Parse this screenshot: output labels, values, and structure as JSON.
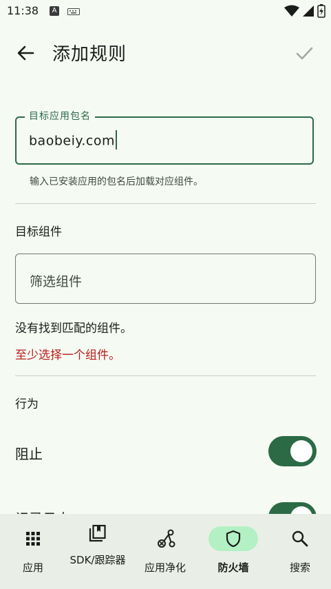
{
  "status_bar": {
    "time": "11:38",
    "notif_letter": "A"
  },
  "app_bar": {
    "title": "添加规则"
  },
  "package_field": {
    "label": "目标应用包名",
    "value": "baobeiy.com",
    "helper": "输入已安装应用的包名后加载对应组件。"
  },
  "components": {
    "heading": "目标组件",
    "filter_placeholder": "筛选组件",
    "empty_text": "没有找到匹配的组件。",
    "error_text": "至少选择一个组件。"
  },
  "behavior": {
    "heading": "行为",
    "block_label": "阻止",
    "block_on": true,
    "log_label": "记录日志",
    "log_on": true
  },
  "bottom_nav": {
    "items": [
      {
        "label": "应用",
        "icon": "grid-icon",
        "selected": false
      },
      {
        "label": "SDK/跟踪器",
        "icon": "library-icon",
        "selected": false
      },
      {
        "label": "应用净化",
        "icon": "purify-icon",
        "selected": false
      },
      {
        "label": "防火墙",
        "icon": "shield-icon",
        "selected": true
      },
      {
        "label": "搜索",
        "icon": "search-icon",
        "selected": false
      }
    ]
  },
  "colors": {
    "accent": "#2b6a45",
    "error": "#ba1a1a",
    "selected_pill": "#b3f0c4"
  }
}
